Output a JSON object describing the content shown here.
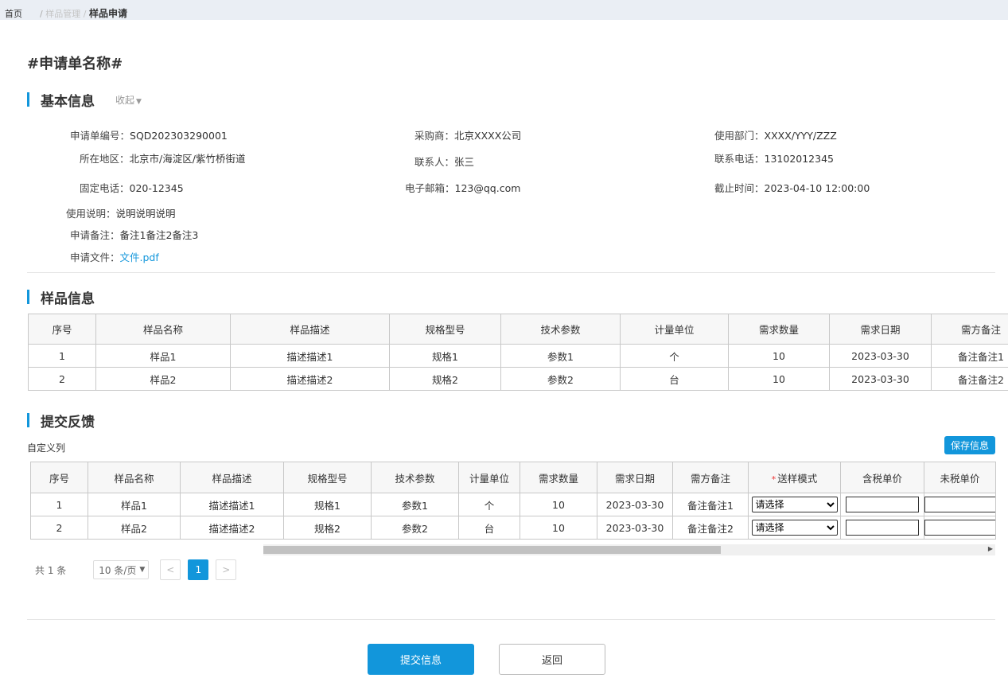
{
  "breadcrumb": {
    "home": "首页",
    "sep": "/",
    "mid": "样品管理",
    "current": "样品申请"
  },
  "page_title": "#申请单名称#",
  "basic": {
    "title": "基本信息",
    "collapse_label": "收起",
    "fields": {
      "apply_no": {
        "label": "申请单编号：",
        "value": "SQD202303290001"
      },
      "buyer": {
        "label": "采购商：",
        "value": "北京XXXX公司"
      },
      "dept": {
        "label": "使用部门：",
        "value": "XXXX/YYY/ZZZ"
      },
      "region": {
        "label": "所在地区：",
        "value": "北京市/海淀区/紫竹桥街道"
      },
      "contact": {
        "label": "联系人：",
        "value": "张三"
      },
      "phone": {
        "label": "联系电话：",
        "value": "13102012345"
      },
      "landline": {
        "label": "固定电话：",
        "value": "020-12345"
      },
      "email": {
        "label": "电子邮箱：",
        "value": "123@qq.com"
      },
      "deadline": {
        "label": "截止时间：",
        "value": "2023-04-10 12:00:00"
      },
      "usage": {
        "label": "使用说明：",
        "value": "说明说明说明"
      },
      "remark": {
        "label": "申请备注：",
        "value": "备注1备注2备注3"
      },
      "file": {
        "label": "申请文件：",
        "value": "文件.pdf"
      }
    }
  },
  "samples": {
    "title": "样品信息",
    "headers": [
      "序号",
      "样品名称",
      "样品描述",
      "规格型号",
      "技术参数",
      "计量单位",
      "需求数量",
      "需求日期",
      "需方备注"
    ],
    "rows": [
      [
        "1",
        "样品1",
        "描述描述1",
        "规格1",
        "参数1",
        "个",
        "10",
        "2023-03-30",
        "备注备注1"
      ],
      [
        "2",
        "样品2",
        "描述描述2",
        "规格2",
        "参数2",
        "台",
        "10",
        "2023-03-30",
        "备注备注2"
      ]
    ]
  },
  "feedback": {
    "title": "提交反馈",
    "custom_columns": "自定义列",
    "save_label": "保存信息",
    "required_mark": "*",
    "headers": [
      "序号",
      "样品名称",
      "样品描述",
      "规格型号",
      "技术参数",
      "计量单位",
      "需求数量",
      "需求日期",
      "需方备注",
      "送样模式",
      "含税单价",
      "未税单价"
    ],
    "rows": [
      {
        "cells": [
          "1",
          "样品1",
          "描述描述1",
          "规格1",
          "参数1",
          "个",
          "10",
          "2023-03-30",
          "备注备注1"
        ],
        "mode": "请选择",
        "tax_price": "",
        "notax_price": ""
      },
      {
        "cells": [
          "2",
          "样品2",
          "描述描述2",
          "规格2",
          "参数2",
          "台",
          "10",
          "2023-03-30",
          "备注备注2"
        ],
        "mode": "请选择",
        "tax_price": "",
        "notax_price": ""
      }
    ]
  },
  "pagination": {
    "total": "共 1 条",
    "page_size": "10 条/页",
    "current": "1",
    "prev": "<",
    "next": ">"
  },
  "actions": {
    "submit": "提交信息",
    "back": "返回"
  },
  "colors": {
    "accent": "#1296db",
    "border": "#c8c8c8",
    "topbar": "#eaeef4"
  }
}
